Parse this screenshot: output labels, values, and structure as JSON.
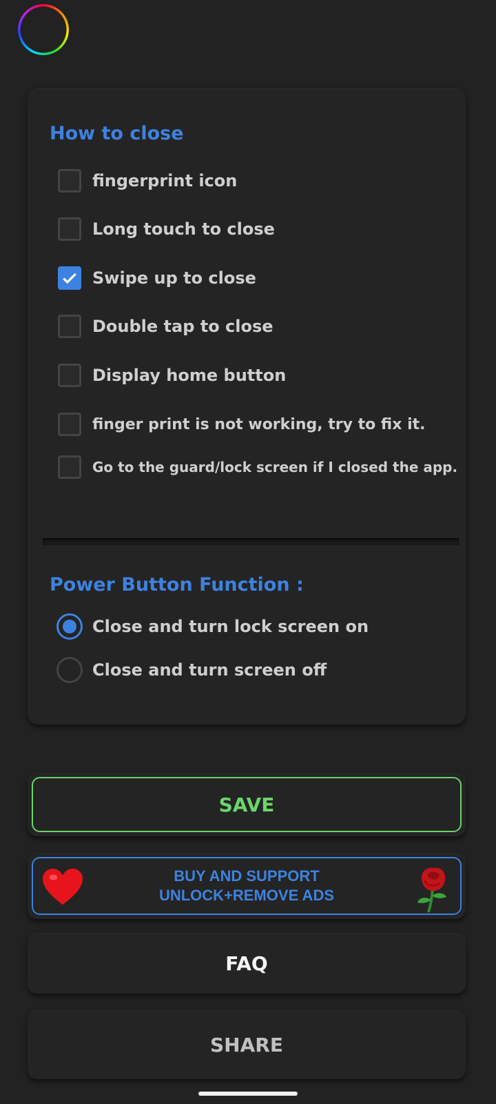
{
  "close_section": {
    "title": "How to close",
    "options": [
      {
        "label": "fingerprint icon",
        "checked": false
      },
      {
        "label": "Long touch to close",
        "checked": false
      },
      {
        "label": "Swipe up to close",
        "checked": true
      },
      {
        "label": "Double tap to close",
        "checked": false
      },
      {
        "label": "Display home button",
        "checked": false
      },
      {
        "label": "finger print is not working, try to fix it.",
        "checked": false
      },
      {
        "label": "Go to the guard/lock screen if I closed the app.",
        "checked": false
      }
    ]
  },
  "power_section": {
    "title": "Power Button Function :",
    "options": [
      {
        "label": "Close and turn lock screen on",
        "selected": true
      },
      {
        "label": "Close and turn screen off",
        "selected": false
      }
    ]
  },
  "buttons": {
    "save": "SAVE",
    "buy_line1": "BUY AND SUPPORT",
    "buy_line2": "UNLOCK+REMOVE ADS",
    "faq": "FAQ",
    "share": "SHARE"
  },
  "colors": {
    "background": "#222222",
    "accent_blue": "#3d82e0",
    "accent_green": "#6bd46b"
  },
  "icons": {
    "top_left": "rainbow-ring-icon",
    "buy_left": "heart-icon",
    "buy_right": "rose-icon"
  }
}
